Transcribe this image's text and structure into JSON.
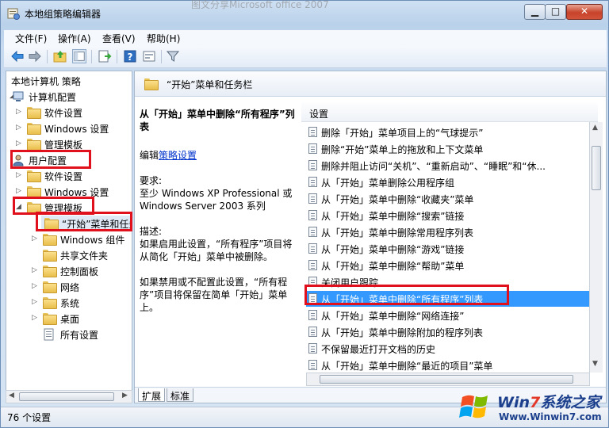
{
  "window": {
    "title": "本地组策略编辑器",
    "background_tab_text": "图文分享Microsoft office 2007",
    "minimize": "▁",
    "maximize": "□",
    "close": "✕"
  },
  "menubar": [
    "文件(F)",
    "操作(A)",
    "查看(V)",
    "帮助(H)"
  ],
  "toolbar": {
    "icons": [
      "back-arrow-icon",
      "forward-arrow-icon",
      "up-folder-icon",
      "show-hide-tree-icon",
      "export-list-icon",
      "help-icon",
      "properties-icon",
      "filter-icon"
    ]
  },
  "tree": {
    "root": "本地计算机 策略",
    "computer_config": "计算机配置",
    "computer_children": [
      "软件设置",
      "Windows 设置",
      "管理模板"
    ],
    "user_config": "用户配置",
    "user_children": [
      "软件设置",
      "Windows 设置"
    ],
    "admin_templates": "管理模板",
    "admin_children": [
      "“开始”菜单和任务栏",
      "Windows 组件",
      "共享文件夹",
      "控制面板",
      "网络",
      "系统",
      "桌面",
      "所有设置"
    ]
  },
  "right_pane": {
    "header": "“开始”菜单和任务栏",
    "description": {
      "title": "从「开始」菜单中删除“所有程序”列表",
      "edit_prefix": "编辑",
      "edit_link": "策略设置",
      "requirement_label": "要求:",
      "requirement_text": "至少 Windows XP Professional 或 Windows Server 2003 系列",
      "desc_label": "描述:",
      "desc_text": "如果启用此设置，“所有程序”项目将从简化「开始」菜单中被删除。",
      "desc_text2": "如果禁用或不配置此设置，“所有程序”项目将保留在简单「开始」菜单上。"
    },
    "column_header": "设置",
    "settings": [
      "删除「开始」菜单项目上的“气球提示”",
      "删除“开始”菜单上的拖放和上下文菜单",
      "删除并阻止访问“关机”、“重新启动”、“睡眠”和“休...",
      "从「开始」菜单删除公用程序组",
      "从「开始」菜单中删除“收藏夹”菜单",
      "从「开始」菜单中删除“搜索”链接",
      "从「开始」菜单中删除常用程序列表",
      "从「开始」菜单中删除“游戏”链接",
      "从「开始」菜单中删除“帮助”菜单",
      "关闭用户跟踪",
      "从「开始」菜单中删除“所有程序”列表",
      "从「开始」菜单中删除“网络连接”",
      "从「开始」菜单中删除附加的程序列表",
      "不保留最近打开文档的历史",
      "从「开始」菜单中删除“最近的项目”菜单"
    ],
    "selected_index": 10,
    "tabs": [
      "扩展",
      "标准"
    ]
  },
  "status": "76 个设置",
  "watermark": {
    "brand_a": "Win",
    "brand_b": "7",
    "brand_c": "系统之家",
    "url": "Www.Winwin7.com"
  }
}
